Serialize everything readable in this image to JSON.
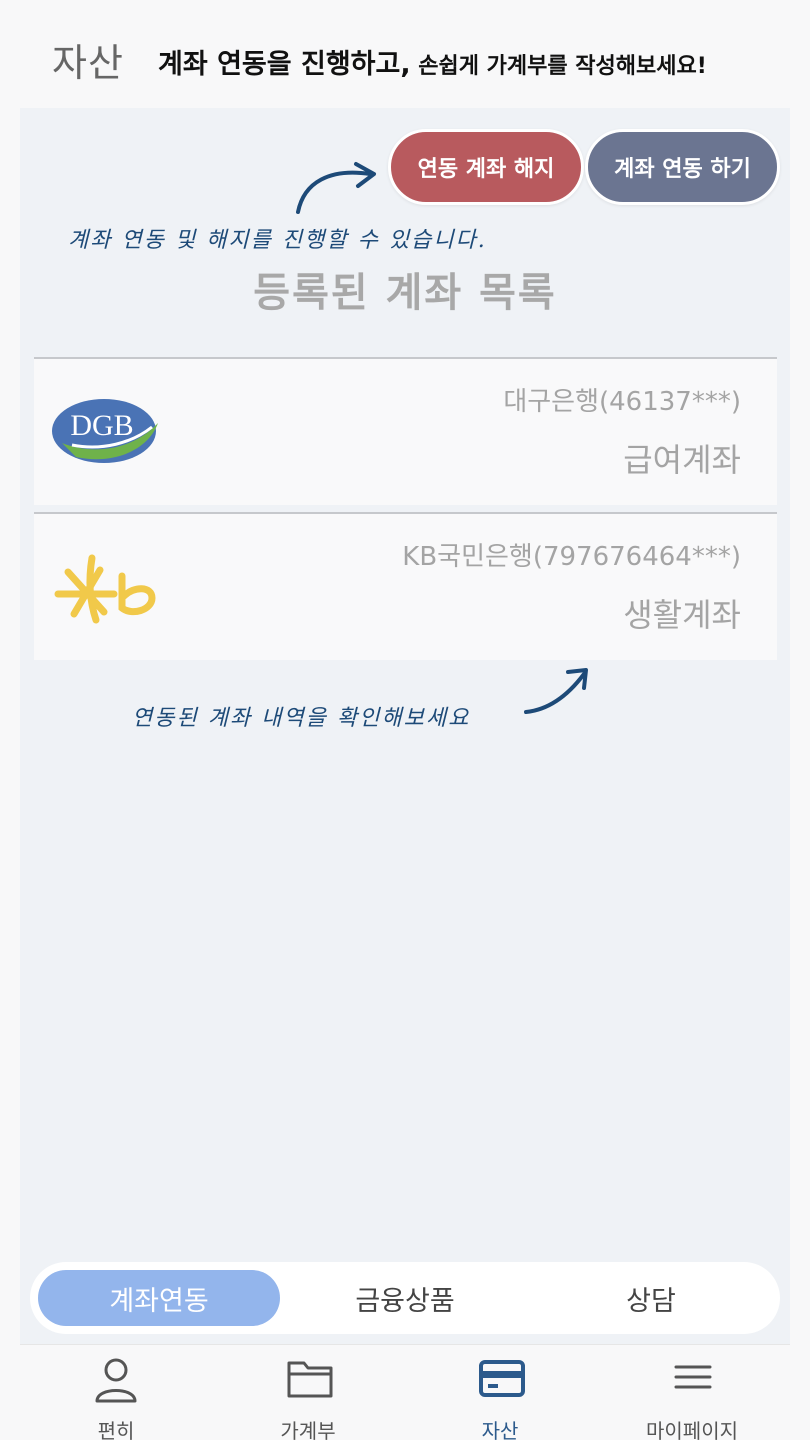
{
  "header": {
    "title": "자산",
    "promo_bold": "계좌 연동을 진행하고,",
    "promo_rest": " 손쉽게 가계부를 작성해보세요!"
  },
  "actions": {
    "unlink_label": "연동 계좌 해지",
    "link_label": "계좌 연동 하기",
    "unlink_color": "#b85a5e",
    "link_color": "#6b7591"
  },
  "annotations": {
    "top": "계좌 연동 및 해지를 진행할 수 있습니다.",
    "bottom": "연동된 계좌 내역을 확인해보세요"
  },
  "section_title": "등록된 계좌 목록",
  "accounts": [
    {
      "logo": "dgb-logo",
      "logo_text": "DGB",
      "name": "대구은행(46137***)",
      "type": "급여계좌"
    },
    {
      "logo": "kb-logo",
      "name": "KB국민은행(797676464***)",
      "type": "생활계좌"
    }
  ],
  "segment": {
    "items": [
      "계좌연동",
      "금융상품",
      "상담"
    ],
    "active": "계좌연동",
    "active_color": "#93b5ec"
  },
  "nav": {
    "items": [
      {
        "icon": "person-icon",
        "label": "편히"
      },
      {
        "icon": "folder-icon",
        "label": "가계부"
      },
      {
        "icon": "card-icon",
        "label": "자산"
      },
      {
        "icon": "menu-icon",
        "label": "마이페이지"
      }
    ],
    "active": "자산",
    "active_color": "#2c5a8c"
  }
}
